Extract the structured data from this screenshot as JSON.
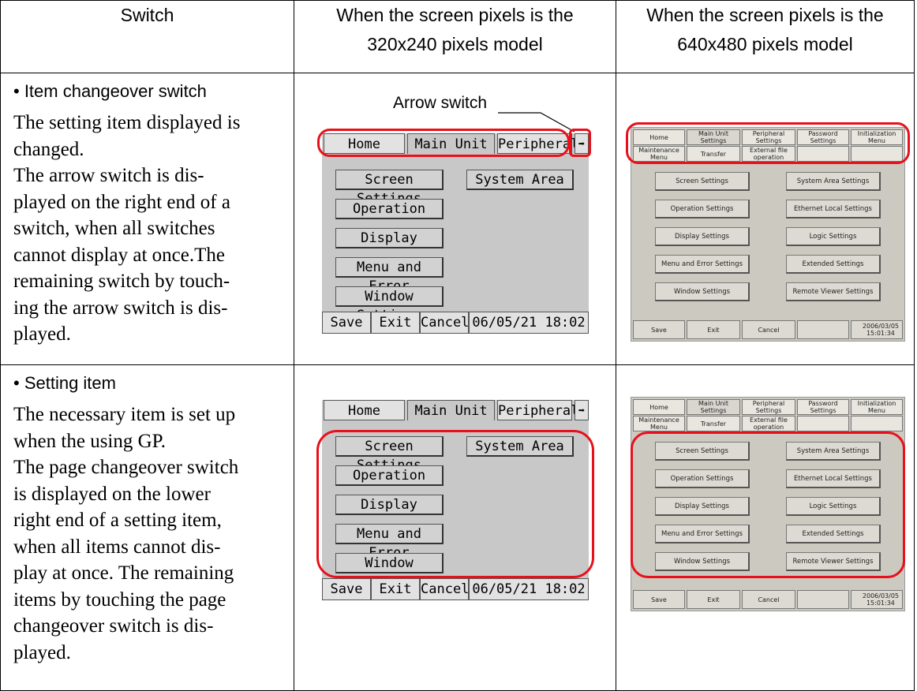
{
  "header": {
    "col1": "Switch",
    "col2_line1": "When the screen pixels is the",
    "col2_line2": "320x240 pixels model",
    "col3_line1": "When the screen pixels is the",
    "col3_line2": "640x480 pixels model"
  },
  "rows": [
    {
      "bullet": "• Item changeover switch",
      "desc": "The setting item displayed is\nchanged.\nThe arrow switch is dis-\nplayed on the right end of a\nswitch, when all switches\ncannot display at once.The\nremaining switch by touch-\ning the arrow switch is dis-\nplayed."
    },
    {
      "bullet": "• Setting item",
      "desc": "The necessary item is set up\nwhen the using GP.\nThe page changeover switch\nis displayed on the lower\nright end of a setting item,\nwhen all items cannot dis-\nplay at once. The remaining\nitems by touching the page\nchangeover switch is dis-\nplayed."
    }
  ],
  "callout": "Arrow switch",
  "small_screen": {
    "tabs": [
      "Home",
      "Main Unit",
      "Peripheral"
    ],
    "arrow": "➡",
    "buttons": [
      "Screen Settings",
      "System Area",
      "Operation",
      "Display",
      "Menu and Error",
      "Window Settings"
    ],
    "bottom": [
      "Save",
      "Exit",
      "Cancel",
      "06/05/21 18:02"
    ]
  },
  "large_screen": {
    "tabs_row1": [
      "Home",
      "Main Unit\nSettings",
      "Peripheral\nSettings",
      "Password\nSettings",
      "Initialization\nMenu"
    ],
    "tabs_row2": [
      "Maintenance\nMenu",
      "Transfer",
      "External file\noperation",
      "",
      ""
    ],
    "buttons_left": [
      "Screen Settings",
      "Operation Settings",
      "Display Settings",
      "Menu and Error Settings",
      "Window Settings"
    ],
    "buttons_right": [
      "System Area Settings",
      "Ethernet Local Settings",
      "Logic Settings",
      "Extended Settings",
      "Remote Viewer Settings"
    ],
    "bottom": [
      "Save",
      "Exit",
      "Cancel",
      "",
      "2006/03/05\n15:01:34"
    ]
  },
  "colors": {
    "highlight": "#e8101a",
    "screen_bg": "#c8c8c8"
  }
}
